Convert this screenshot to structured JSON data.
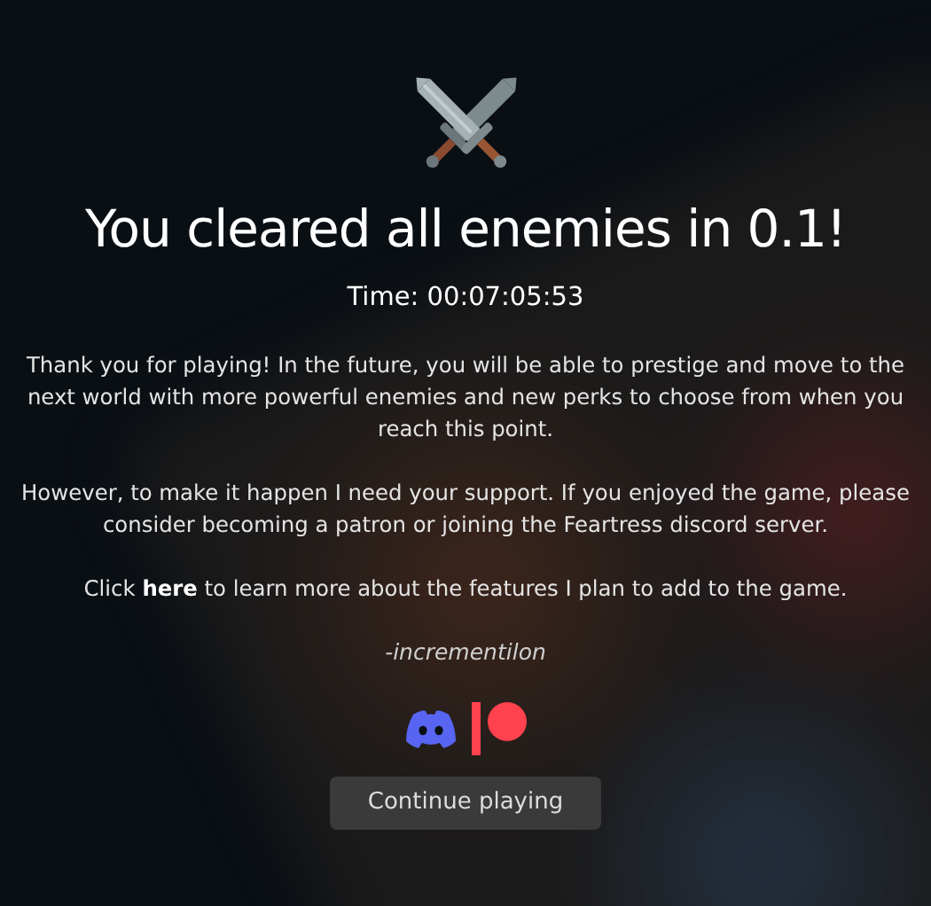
{
  "title": "You cleared all enemies in 0.1!",
  "time": "Time: 00:07:05:53",
  "paragraphs": [
    {
      "text": "Thank you for playing! In the future, you will be able to prestige and move to the next world with more powerful enemies and new perks to choose from when you reach this point."
    },
    {
      "text": "However, to make it happen I need your support. If you enjoyed the game, please consider becoming a patron or joining the Feartress discord server."
    }
  ],
  "link_sentence": {
    "before": "Click",
    "link": "here",
    "after": "to learn more about the features I plan to add to the game."
  },
  "signature": "-incrementilon",
  "socials": [
    {
      "kind": "discord",
      "color": "#5865f2"
    },
    {
      "kind": "patreon",
      "color": "#ff424d"
    }
  ],
  "button": "Continue playing"
}
